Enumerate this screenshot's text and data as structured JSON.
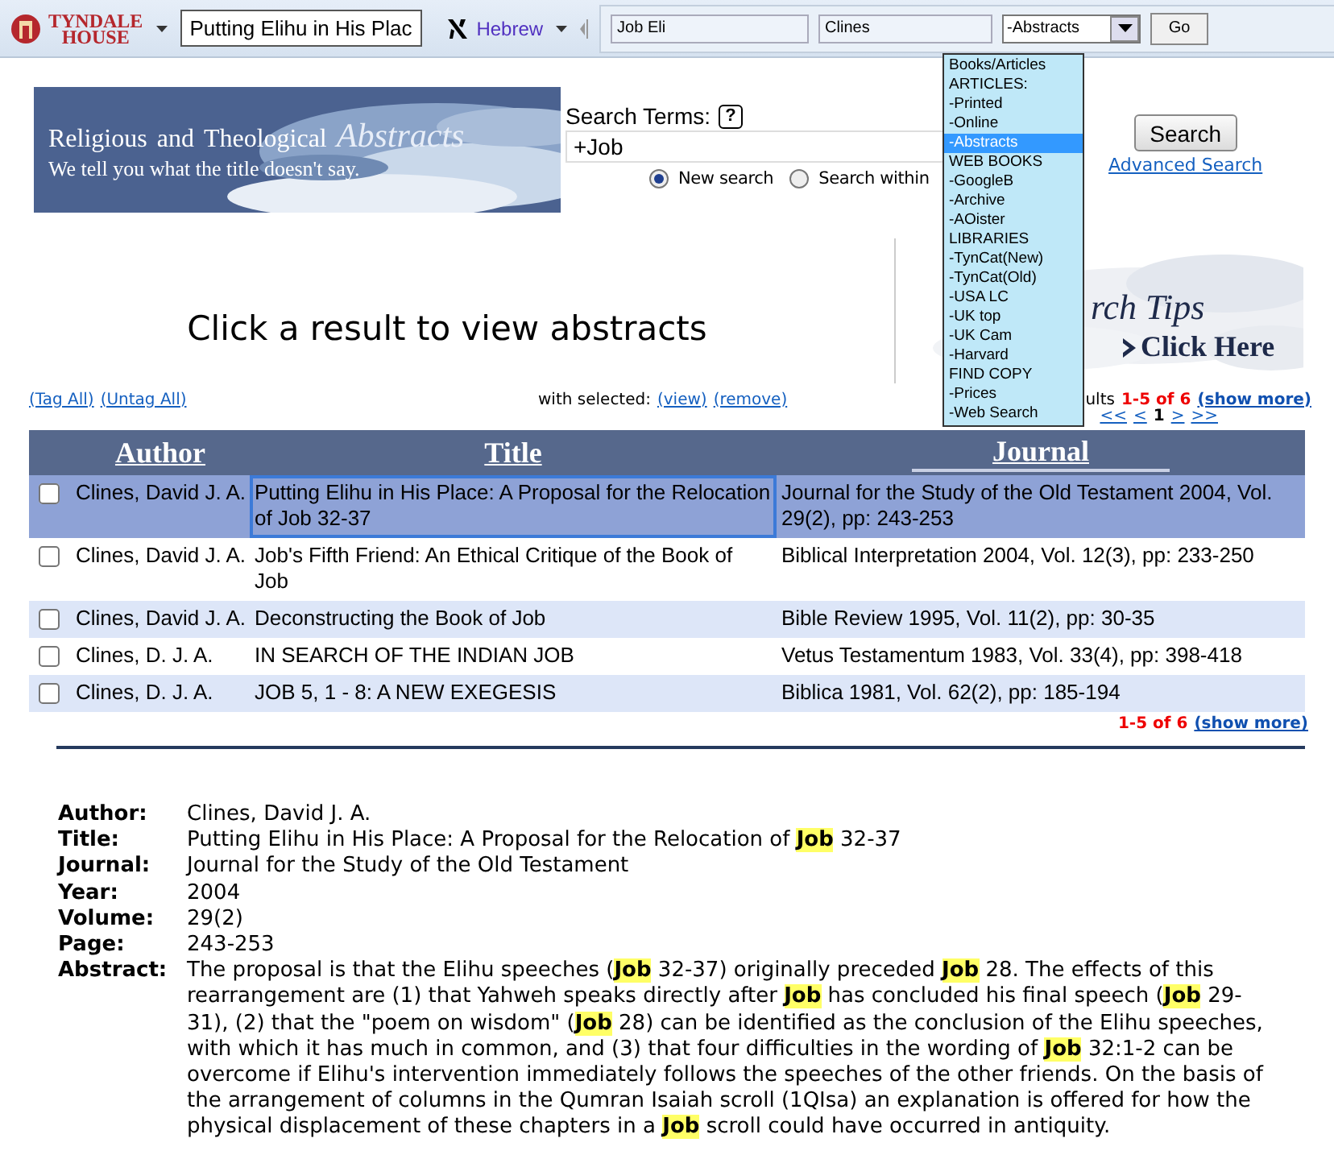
{
  "toolbar": {
    "logo_lines": [
      "TYNDALE",
      "HOUSE"
    ],
    "book_select": "Putting Elihu in His Plac",
    "language_link": "Hebrew",
    "fields": [
      "Job Eli",
      "Clines"
    ],
    "source_select": "-Abstracts",
    "go_button": "Go"
  },
  "source_menu": [
    {
      "label": "Books/Articles",
      "selected": false
    },
    {
      "label": "ARTICLES:",
      "selected": false
    },
    {
      "label": "-Printed",
      "selected": false
    },
    {
      "label": "-Online",
      "selected": false
    },
    {
      "label": "-Abstracts",
      "selected": true
    },
    {
      "label": "WEB BOOKS",
      "selected": false
    },
    {
      "label": "-GoogleB",
      "selected": false
    },
    {
      "label": "-Archive",
      "selected": false
    },
    {
      "label": "-AOister",
      "selected": false
    },
    {
      "label": "LIBRARIES",
      "selected": false
    },
    {
      "label": "-TynCat(New)",
      "selected": false
    },
    {
      "label": "-TynCat(Old)",
      "selected": false
    },
    {
      "label": "-USA LC",
      "selected": false
    },
    {
      "label": "-UK top",
      "selected": false
    },
    {
      "label": "-UK Cam",
      "selected": false
    },
    {
      "label": "-Harvard",
      "selected": false
    },
    {
      "label": "FIND COPY",
      "selected": false
    },
    {
      "label": "-Prices",
      "selected": false
    },
    {
      "label": "-Web Search",
      "selected": false
    }
  ],
  "banner": {
    "title_parts": [
      "Religious",
      "and",
      "Theological",
      "Abstracts"
    ],
    "tagline": "We tell you what the title doesn't say."
  },
  "search": {
    "label": "Search Terms:",
    "help": "?",
    "value": "+Job",
    "button": "Search",
    "advanced_link": "Advanced Search",
    "modes": [
      {
        "label": "New search",
        "selected": true
      },
      {
        "label": "Search within",
        "selected": false
      }
    ]
  },
  "prompt": "Click a result to view abstracts",
  "tips": {
    "title": "rch Tips",
    "link": "Click Here"
  },
  "tag_links": [
    "(Tag All)",
    "(Untag All)"
  ],
  "with_selected": {
    "label": "with selected:",
    "links": [
      "(view)",
      "(remove)"
    ]
  },
  "results_top": {
    "label": "ults",
    "count": "1-5 of 6",
    "more": "(show more)"
  },
  "pager": [
    "<<",
    "<",
    "1",
    ">",
    ">>"
  ],
  "table": {
    "columns": [
      "Author",
      "Title",
      "Journal"
    ],
    "rows": [
      {
        "checked": false,
        "selected": true,
        "author": "Clines, David J. A.",
        "title": "Putting Elihu in His Place: A Proposal for the Relocation of Job 32-37",
        "journal": "Journal for the Study of the Old Testament 2004, Vol. 29(2), pp: 243-253"
      },
      {
        "checked": false,
        "selected": false,
        "author": "Clines, David J. A.",
        "title": "Job's Fifth Friend: An Ethical Critique of the Book of Job",
        "journal": "Biblical Interpretation 2004, Vol. 12(3), pp: 233-250"
      },
      {
        "checked": false,
        "selected": false,
        "author": "Clines, David J. A.",
        "title": "Deconstructing the Book of Job",
        "journal": "Bible Review 1995, Vol. 11(2), pp: 30-35"
      },
      {
        "checked": false,
        "selected": false,
        "author": "Clines, D. J. A.",
        "title": "IN SEARCH OF THE INDIAN JOB",
        "journal": "Vetus Testamentum 1983, Vol. 33(4), pp: 398-418"
      },
      {
        "checked": false,
        "selected": false,
        "author": "Clines, D. J. A.",
        "title": "JOB 5, 1 - 8: A NEW EXEGESIS",
        "journal": "Biblica 1981, Vol. 62(2), pp: 185-194"
      }
    ]
  },
  "results_bottom": {
    "count": "1-5 of 6",
    "more": "(show more)"
  },
  "details": [
    {
      "label": "Author:",
      "value": "Clines, David J. A."
    },
    {
      "label": "Title:",
      "value": "Putting Elihu in His Place: A Proposal for the Relocation of **Job** 32-37"
    },
    {
      "label": "Journal:",
      "value": "Journal for the Study of the Old Testament"
    },
    {
      "label": "Year:",
      "value": "2004"
    },
    {
      "label": "Volume:",
      "value": "29(2)"
    },
    {
      "label": "Page:",
      "value": "243-253"
    },
    {
      "label": "Abstract:",
      "value": "The proposal is that the Elihu speeches (**Job** 32-37) originally preceded **Job** 28. The effects of this rearrangement are (1) that Yahweh speaks directly after **Job** has concluded his final speech (**Job** 29-31), (2) that the \"poem on wisdom\" (**Job** 28) can be identified as the conclusion of the Elihu speeches, with which it has much in common, and (3) that four difficulties in the wording of **Job** 32:1-2 can be overcome if Elihu's intervention immediately follows the speeches of the other friends. On the basis of the arrangement of columns in the Qumran Isaiah scroll (1QIsa) an explanation is offered for how the physical displacement of these chapters in a **Job** scroll could have occurred in antiquity."
    }
  ]
}
